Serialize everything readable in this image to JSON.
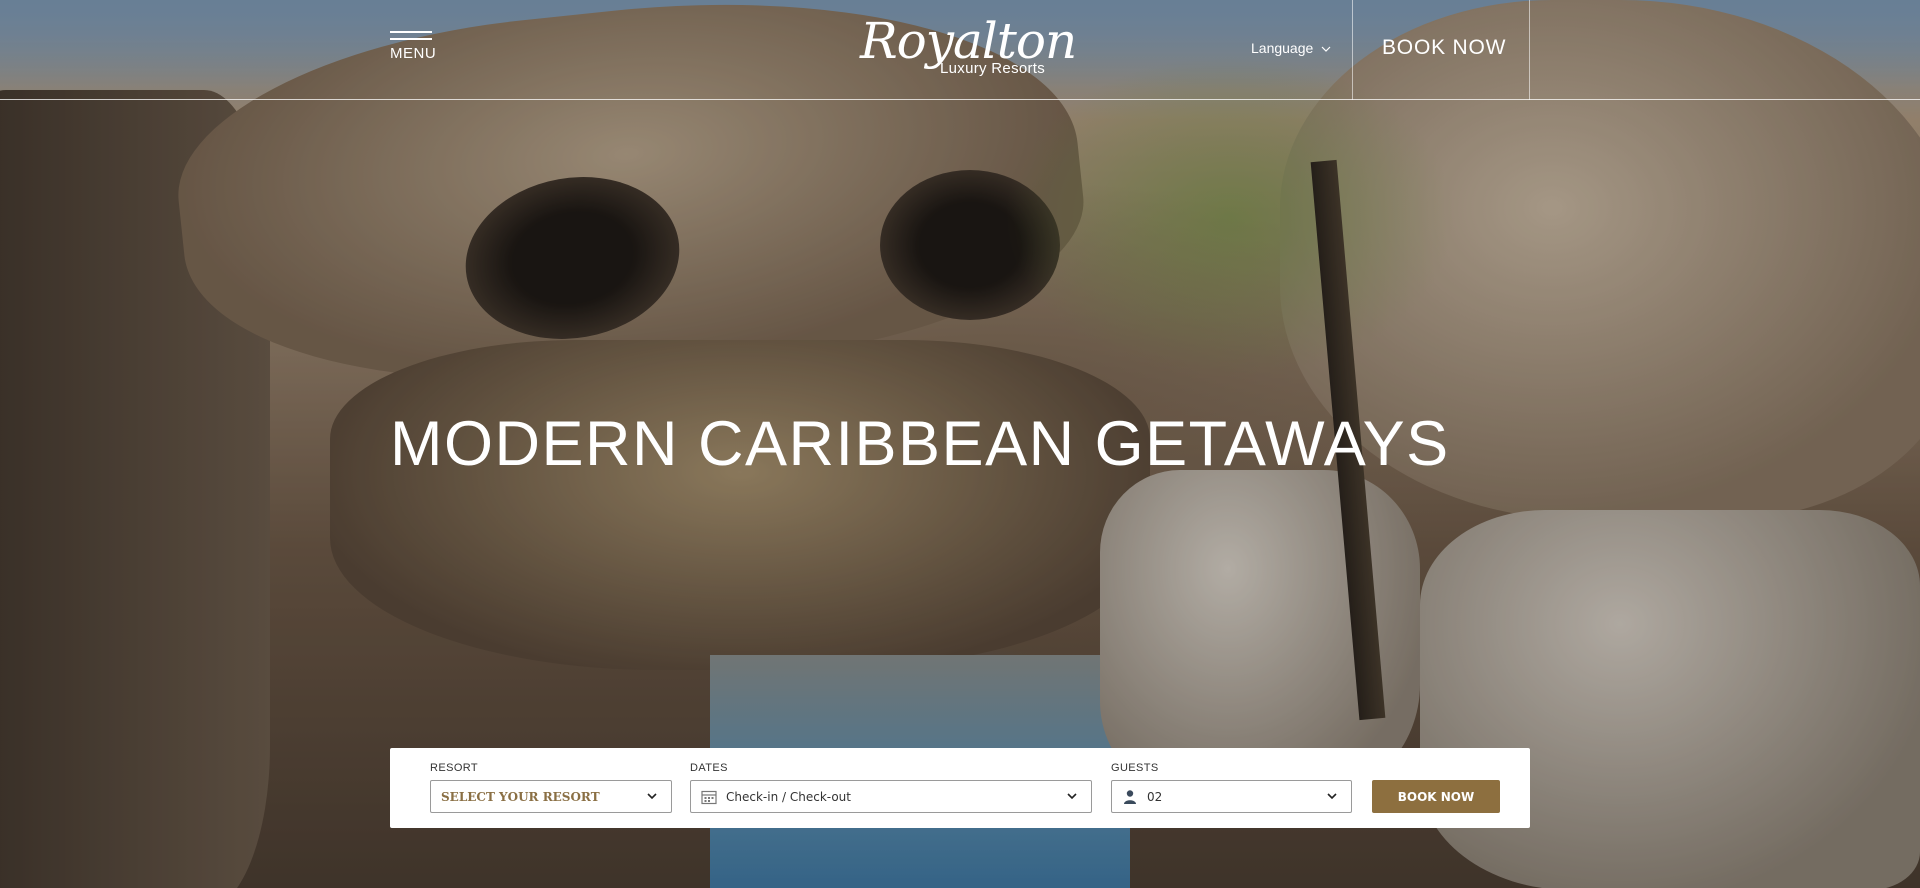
{
  "header": {
    "menu_label": "MENU",
    "logo_mark": "Royalton",
    "logo_tagline": "Luxury Resorts",
    "language_label": "Language",
    "book_now_label": "BOOK NOW"
  },
  "hero": {
    "headline": "MODERN CARIBBEAN GETAWAYS"
  },
  "booking": {
    "resort_label": "RESORT",
    "resort_value": "SELECT YOUR RESORT",
    "dates_label": "DATES",
    "dates_value": "Check-in / Check-out",
    "guests_label": "GUESTS",
    "guests_value": "02",
    "book_button_label": "BOOK NOW"
  },
  "colors": {
    "accent": "#8d6f3f",
    "resort_text": "#8a6f44",
    "header_text": "#ffffff"
  },
  "icons": {
    "menu": "hamburger-icon",
    "language": "chevron-down-icon",
    "dates": "calendar-icon",
    "guests": "user-icon",
    "dropdown": "chevron-down-icon"
  }
}
